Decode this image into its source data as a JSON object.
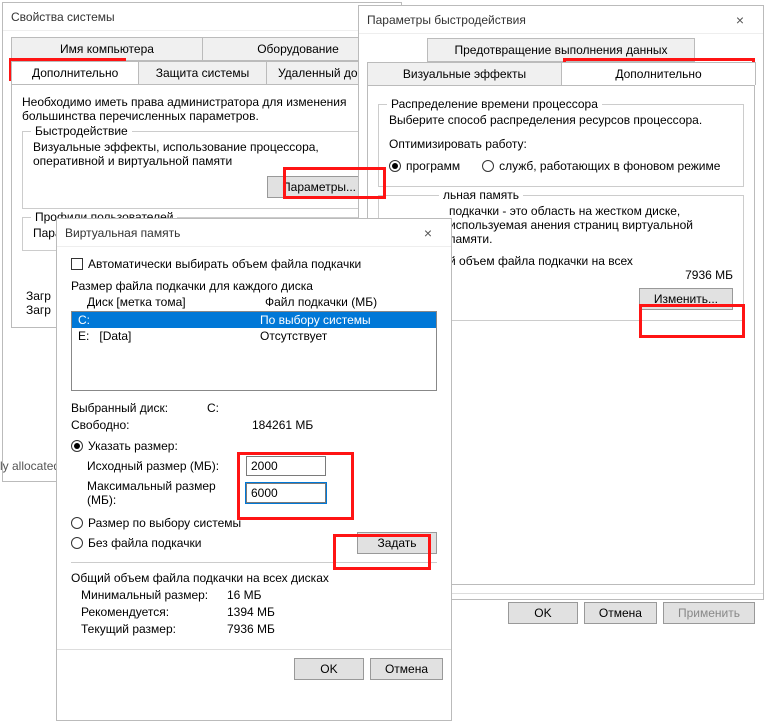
{
  "sysprops": {
    "title": "Свойства системы",
    "tabs_row1": [
      "Имя компьютера",
      "Оборудование"
    ],
    "tabs_row2": [
      "Дополнительно",
      "Защита системы",
      "Удаленный доступ"
    ],
    "admin_note": "Необходимо иметь права администратора для изменения большинства перечисленных параметров.",
    "perf": {
      "title": "Быстродействие",
      "desc": "Визуальные эффекты, использование процессора, оперативной и виртуальной памяти",
      "btn": "Параметры..."
    },
    "profiles": {
      "title": "Профили пользователей",
      "line": "Пара"
    },
    "startup": {
      "line1": "Загр",
      "line2": "Загр"
    }
  },
  "perfopts": {
    "title": "Параметры быстродействия",
    "dep_tab": "Предотвращение выполнения данных",
    "tabs": [
      "Визуальные эффекты",
      "Дополнительно"
    ],
    "sched": {
      "title": "Распределение времени процессора",
      "desc": "Выберите способ распределения ресурсов процессора.",
      "opt_label": "Оптимизировать работу:",
      "opt_programs": "программ",
      "opt_services": "служб, работающих в фоновом режиме"
    },
    "vm": {
      "title_suffix": "льная память",
      "desc": "подкачки - это область на жестком диске, используемая анения страниц виртуальной памяти.",
      "total_label": "й объем файла подкачки на всех",
      "total_value": "7936 МБ",
      "change_btn": "Изменить..."
    },
    "btns": {
      "ok": "OK",
      "cancel": "Отмена",
      "apply": "Применить"
    }
  },
  "vmdlg": {
    "title": "Виртуальная память",
    "auto_label": "Автоматически выбирать объем файла подкачки",
    "size_each_label": "Размер файла подкачки для каждого диска",
    "col_drive": "Диск [метка тома]",
    "col_file": "Файл подкачки (МБ)",
    "drives": [
      {
        "d": "C:",
        "label": "",
        "val": "По выбору системы",
        "sel": true
      },
      {
        "d": "E:",
        "label": "[Data]",
        "val": "Отсутствует",
        "sel": false
      }
    ],
    "sel_drive_label": "Выбранный диск:",
    "sel_drive": "C:",
    "free_label": "Свободно:",
    "free_val": "184261 МБ",
    "custom_label": "Указать размер:",
    "init_label": "Исходный размер (МБ):",
    "init_val": "2000",
    "max_label": "Максимальный размер (МБ):",
    "max_val": "6000",
    "sys_label": "Размер по выбору системы",
    "none_label": "Без файла подкачки",
    "set_btn": "Задать",
    "total_title": "Общий объем файла подкачки на всех дисках",
    "min_label": "Минимальный размер:",
    "min_val": "16 МБ",
    "rec_label": "Рекомендуется:",
    "rec_val": "1394 МБ",
    "cur_label": "Текущий размер:",
    "cur_val": "7936 МБ",
    "ok": "OK",
    "cancel": "Отмена"
  },
  "side_text": "ly allocated"
}
